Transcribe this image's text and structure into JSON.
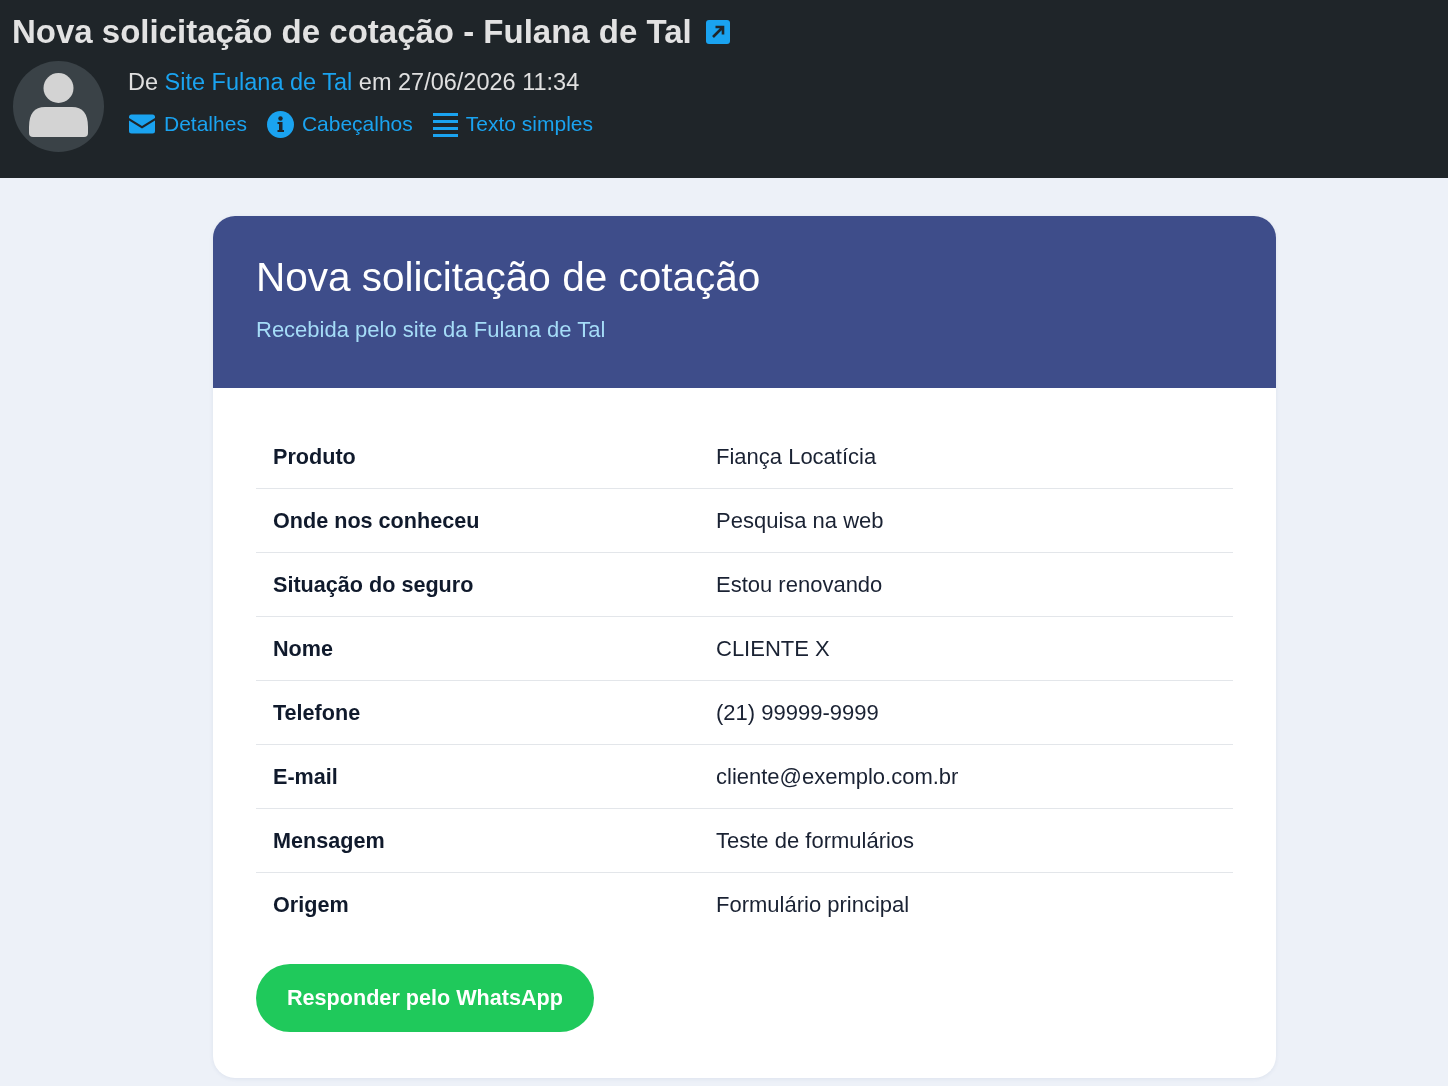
{
  "message": {
    "subject": "Nova solicitação de cotação - Fulana de Tal",
    "from_prefix": "De",
    "sender": "Site Fulana de Tal",
    "date_prefix": "em",
    "date": "27/06/2026 11:34",
    "links": [
      {
        "kind": "details",
        "label": "Detalhes"
      },
      {
        "kind": "headers",
        "label": "Cabeçalhos"
      },
      {
        "kind": "plain_text",
        "label": "Texto simples"
      }
    ]
  },
  "email": {
    "title": "Nova solicitação de cotação",
    "subtitle": "Recebida pelo site da Fulana de Tal",
    "fields": [
      {
        "label": "Produto",
        "value": "Fiança Locatícia"
      },
      {
        "label": "Onde nos conheceu",
        "value": "Pesquisa na web"
      },
      {
        "label": "Situação do seguro",
        "value": "Estou renovando"
      },
      {
        "label": "Nome",
        "value": "CLIENTE X"
      },
      {
        "label": "Telefone",
        "value": "(21) 99999-9999"
      },
      {
        "label": "E-mail",
        "value": "cliente@exemplo.com.br"
      },
      {
        "label": "Mensagem",
        "value": "Teste de formulários"
      },
      {
        "label": "Origem",
        "value": "Formulário principal"
      }
    ],
    "button": "Responder pelo WhatsApp"
  }
}
